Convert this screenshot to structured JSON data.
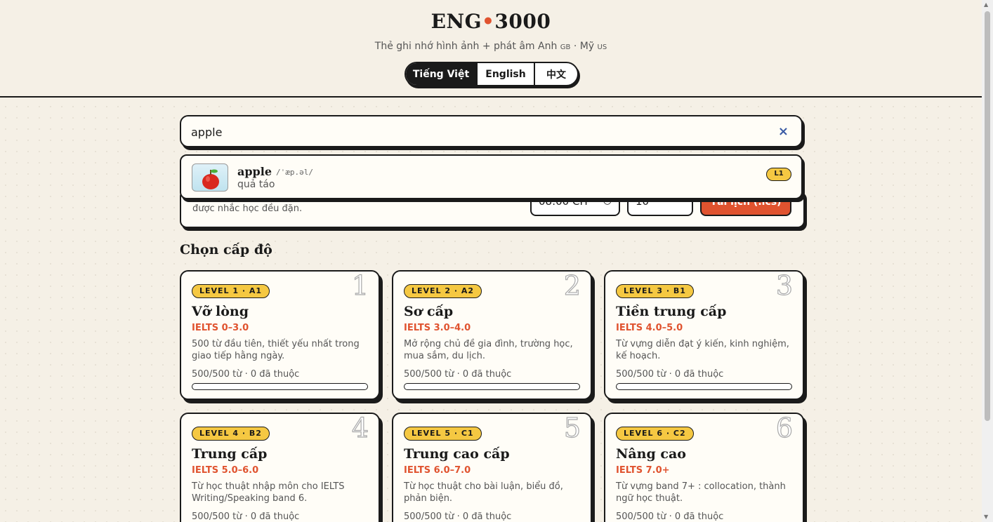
{
  "header": {
    "logo_left": "ENG",
    "logo_dot": "•",
    "logo_right": "3000",
    "subtitle_main": "Thẻ ghi nhớ hình ảnh + phát âm Anh ",
    "subtitle_gb": "GB",
    "subtitle_sep": " · Mỹ ",
    "subtitle_us": "US",
    "languages": [
      "Tiếng Việt",
      "English",
      "中文"
    ],
    "active_language": "Tiếng Việt"
  },
  "search": {
    "value": "apple",
    "clear_icon": "×"
  },
  "suggestion": {
    "word": "apple",
    "ipa": "/ˈæp.əl/",
    "meaning": "quả táo",
    "level": "L1",
    "image_icon": "apple-image"
  },
  "reminder": {
    "text": "được nhắc học đều đặn.",
    "time_value": "08:00 CH",
    "count_value": "10",
    "button_label": "Tải lịch (.ics)"
  },
  "section_title": "Chọn cấp độ",
  "levels": [
    {
      "badge": "LEVEL 1 · A1",
      "num": "1",
      "title": "Vỡ lòng",
      "ielts": "IELTS 0–3.0",
      "desc": "500 từ đầu tiên, thiết yếu nhất trong giao tiếp hằng ngày.",
      "progress": "500/500 từ · 0 đã thuộc",
      "learned_fraction": 0
    },
    {
      "badge": "LEVEL 2 · A2",
      "num": "2",
      "title": "Sơ cấp",
      "ielts": "IELTS 3.0–4.0",
      "desc": "Mở rộng chủ đề gia đình, trường học, mua sắm, du lịch.",
      "progress": "500/500 từ · 0 đã thuộc",
      "learned_fraction": 0
    },
    {
      "badge": "LEVEL 3 · B1",
      "num": "3",
      "title": "Tiền trung cấp",
      "ielts": "IELTS 4.0–5.0",
      "desc": "Từ vựng diễn đạt ý kiến, kinh nghiệm, kế hoạch.",
      "progress": "500/500 từ · 0 đã thuộc",
      "learned_fraction": 0
    },
    {
      "badge": "LEVEL 4 · B2",
      "num": "4",
      "title": "Trung cấp",
      "ielts": "IELTS 5.0–6.0",
      "desc": "Từ học thuật nhập môn cho IELTS Writing/Speaking band 6.",
      "progress": "500/500 từ · 0 đã thuộc",
      "learned_fraction": 0
    },
    {
      "badge": "LEVEL 5 · C1",
      "num": "5",
      "title": "Trung cao cấp",
      "ielts": "IELTS 6.0–7.0",
      "desc": "Từ học thuật cho bài luận, biểu đồ, phản biện.",
      "progress": "500/500 từ · 0 đã thuộc",
      "learned_fraction": 0
    },
    {
      "badge": "LEVEL 6 · C2",
      "num": "6",
      "title": "Nâng cao",
      "ielts": "IELTS 7.0+",
      "desc": "Từ vựng band 7+ : collocation, thành ngữ học thuật.",
      "progress": "500/500 từ · 0 đã thuộc",
      "learned_fraction": 0
    }
  ],
  "colors": {
    "accent": "#e0532f",
    "badge": "#f5c842",
    "background": "#f5f0e6",
    "ink": "#1a1a1a"
  }
}
